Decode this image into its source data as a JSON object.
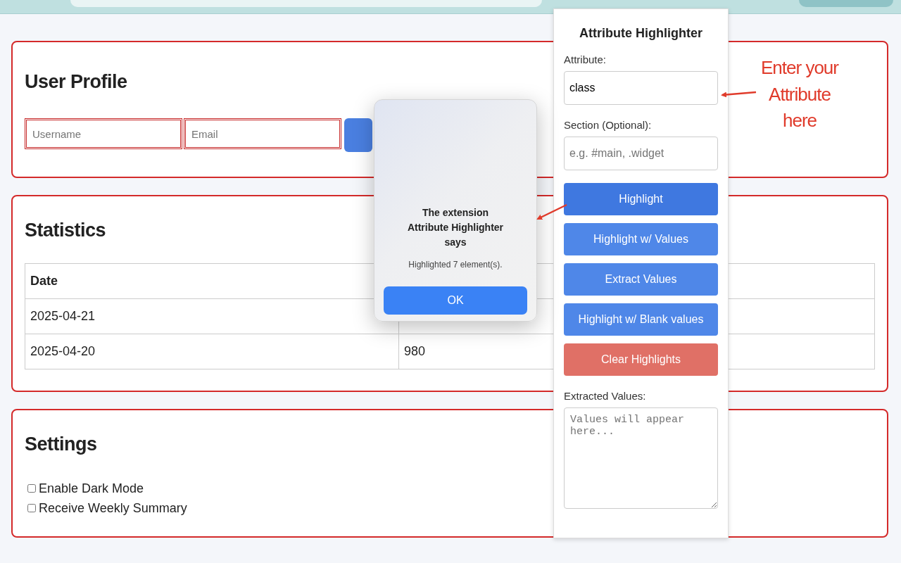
{
  "profile": {
    "title": "User Profile",
    "fields": [
      {
        "placeholder": "Username"
      },
      {
        "placeholder": "Email"
      }
    ]
  },
  "statistics": {
    "title": "Statistics",
    "columns": [
      "Date"
    ],
    "rows": [
      [
        "2025-04-21",
        ""
      ],
      [
        "2025-04-20",
        "980"
      ]
    ]
  },
  "settings": {
    "title": "Settings",
    "options": [
      {
        "label": "Enable Dark Mode",
        "checked": false
      },
      {
        "label": "Receive Weekly Summary",
        "checked": false
      }
    ]
  },
  "extension_popup": {
    "title": "Attribute Highlighter",
    "attribute_label": "Attribute:",
    "attribute_value": "class",
    "section_label": "Section (Optional):",
    "section_placeholder": "e.g. #main, .widget",
    "buttons": [
      {
        "label": "Highlight",
        "kind": "primary"
      },
      {
        "label": "Highlight w/ Values",
        "kind": "secondary"
      },
      {
        "label": "Extract Values",
        "kind": "secondary"
      },
      {
        "label": "Highlight w/ Blank values",
        "kind": "secondary"
      },
      {
        "label": "Clear Highlights",
        "kind": "danger"
      }
    ],
    "extracted_label": "Extracted Values:",
    "extracted_placeholder": "Values will appear here..."
  },
  "alert": {
    "title": "The extension Attribute Highlighter says",
    "message": "Highlighted 7 element(s).",
    "button": "OK"
  },
  "annotation": "Enter your Attribute here"
}
